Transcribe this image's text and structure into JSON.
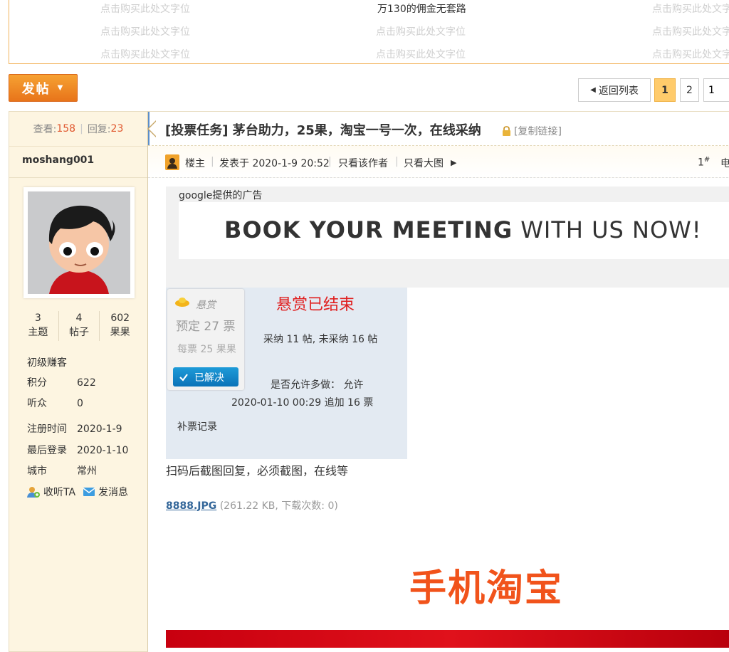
{
  "ads": {
    "row1": [
      "点击购买此处文字位",
      "万130的佣金无套路",
      "点击购买此处文字位"
    ],
    "row2": [
      "点击购买此处文字位",
      "点击购买此处文字位",
      "点击购买此处文字位"
    ],
    "row3": [
      "点击购买此处文字位",
      "点击购买此处文字位",
      "点击购买此处文字位"
    ]
  },
  "toolbar": {
    "post_label": "发帖",
    "back_label": "返回列表"
  },
  "pagination": {
    "current": "1",
    "next": "2",
    "input_value": "1"
  },
  "stats": {
    "views_label": "查看:",
    "views": "158",
    "replies_label": "回复:",
    "replies": "23"
  },
  "author": {
    "username": "moshang001",
    "counts": [
      {
        "value": "3",
        "label": "主题"
      },
      {
        "value": "4",
        "label": "帖子"
      },
      {
        "value": "602",
        "label": "果果"
      }
    ],
    "rank": "初级赚客",
    "points_label": "积分",
    "points": "622",
    "listeners_label": "听众",
    "listeners": "0",
    "reg_label": "注册时间",
    "reg_date": "2020-1-9",
    "last_label": "最后登录",
    "last_date": "2020-1-10",
    "city_label": "城市",
    "city": "常州",
    "follow_label": "收听TA",
    "message_label": "发消息"
  },
  "thread": {
    "title": "[投票任务] 茅台助力，25果，淘宝一号一次，在线采纳",
    "copy_link": "[复制链接]"
  },
  "post_meta": {
    "owner": "楼主",
    "posted": "发表于 2020-1-9 20:52",
    "only_author": "只看该作者",
    "only_images": "只看大图",
    "floor": "1",
    "floor_mark": "#",
    "trailing": "电"
  },
  "google_ad": {
    "label": "google提供的广告",
    "bold_text": "BOOK YOUR MEETING",
    "light_text": " WITH US NOW!"
  },
  "reward": {
    "card_label": "悬赏",
    "amount": "预定 27 票",
    "per_vote": "每票 25 果果",
    "solved": "已解决",
    "status": "悬赏已结束",
    "summary": "采纳 11 帖, 未采纳 16 帖",
    "allow": "是否允许多做： 允许",
    "append": "2020-01-10 00:29 追加 16 票",
    "supplement": "补票记录"
  },
  "post_body": {
    "text": "扫码后截图回复，必须截图，在线等",
    "attachment_name": "8888.JPG",
    "attachment_info": " (261.22 KB, 下载次数: 0)"
  },
  "image": {
    "logo_text": "手机淘宝"
  },
  "colors": {
    "accent_orange": "#e8741a",
    "count_red": "#e0562d",
    "reward_red": "#e02020",
    "solved_blue": "#0b73b8",
    "taobao_orange": "#f1531b"
  }
}
